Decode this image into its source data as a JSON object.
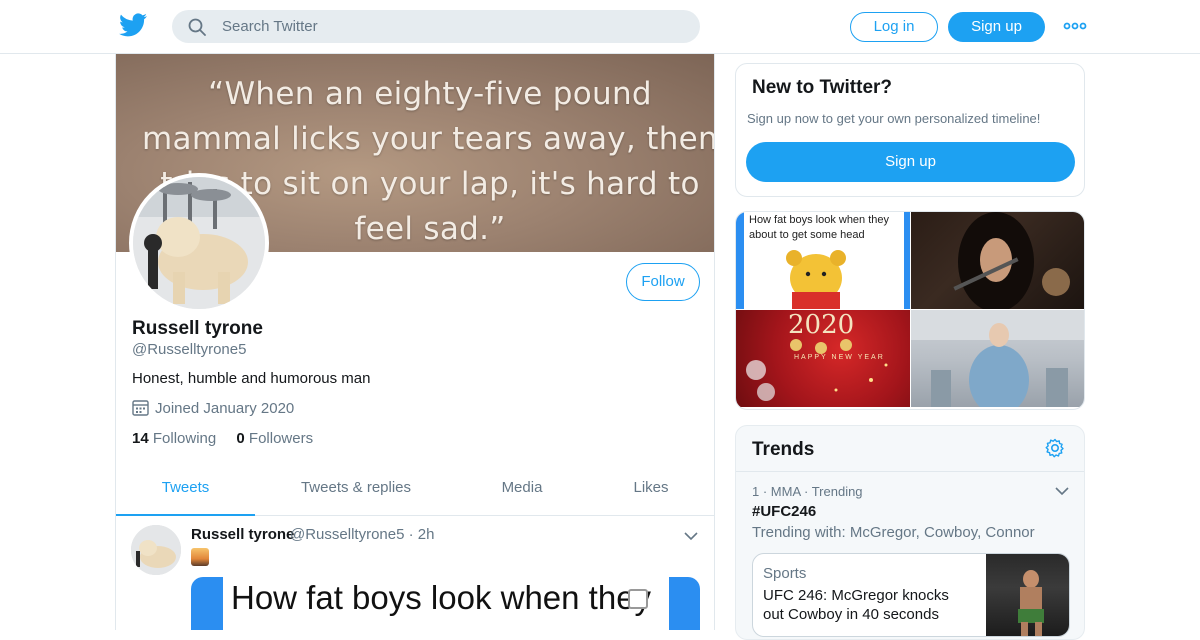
{
  "header": {
    "search_placeholder": "Search Twitter",
    "login_label": "Log in",
    "signup_label": "Sign up"
  },
  "profile": {
    "banner_quote": "“When an eighty-five pound mammal licks your tears away, then tries to sit on your lap, it's hard to feel sad.”",
    "follow_label": "Follow",
    "name": "Russell tyrone",
    "handle": "@Russelltyrone5",
    "bio": "Honest, humble and humorous man",
    "joined": "Joined January 2020",
    "following_count": "14",
    "following_label": "Following",
    "followers_count": "0",
    "followers_label": "Followers"
  },
  "tabs": [
    "Tweets",
    "Tweets & replies",
    "Media",
    "Likes"
  ],
  "tweet": {
    "name": "Russell tyrone",
    "handle_time": "@Russelltyrone5 · 2h",
    "media_text": "How fat boys look when they"
  },
  "new_to_twitter": {
    "title": "New to Twitter?",
    "subtitle": "Sign up now to get your own personalized timeline!",
    "button": "Sign up"
  },
  "media_grid": {
    "tile1_text": "How fat boys look when they about to get some head",
    "tile3_year": "2020",
    "tile3_text": "HAPPY NEW YEAR"
  },
  "trends": {
    "title": "Trends",
    "item": {
      "meta": "1 · MMA · Trending",
      "tag": "#UFC246",
      "trending_with": "Trending with: McGregor, Cowboy, Connor"
    },
    "card": {
      "category": "Sports",
      "headline": "UFC 246: McGregor knocks out Cowboy in 40 seconds"
    }
  },
  "colors": {
    "accent": "#1da1f2",
    "text_primary": "#14171a",
    "text_secondary": "#657786",
    "border": "#e1e8ed"
  }
}
